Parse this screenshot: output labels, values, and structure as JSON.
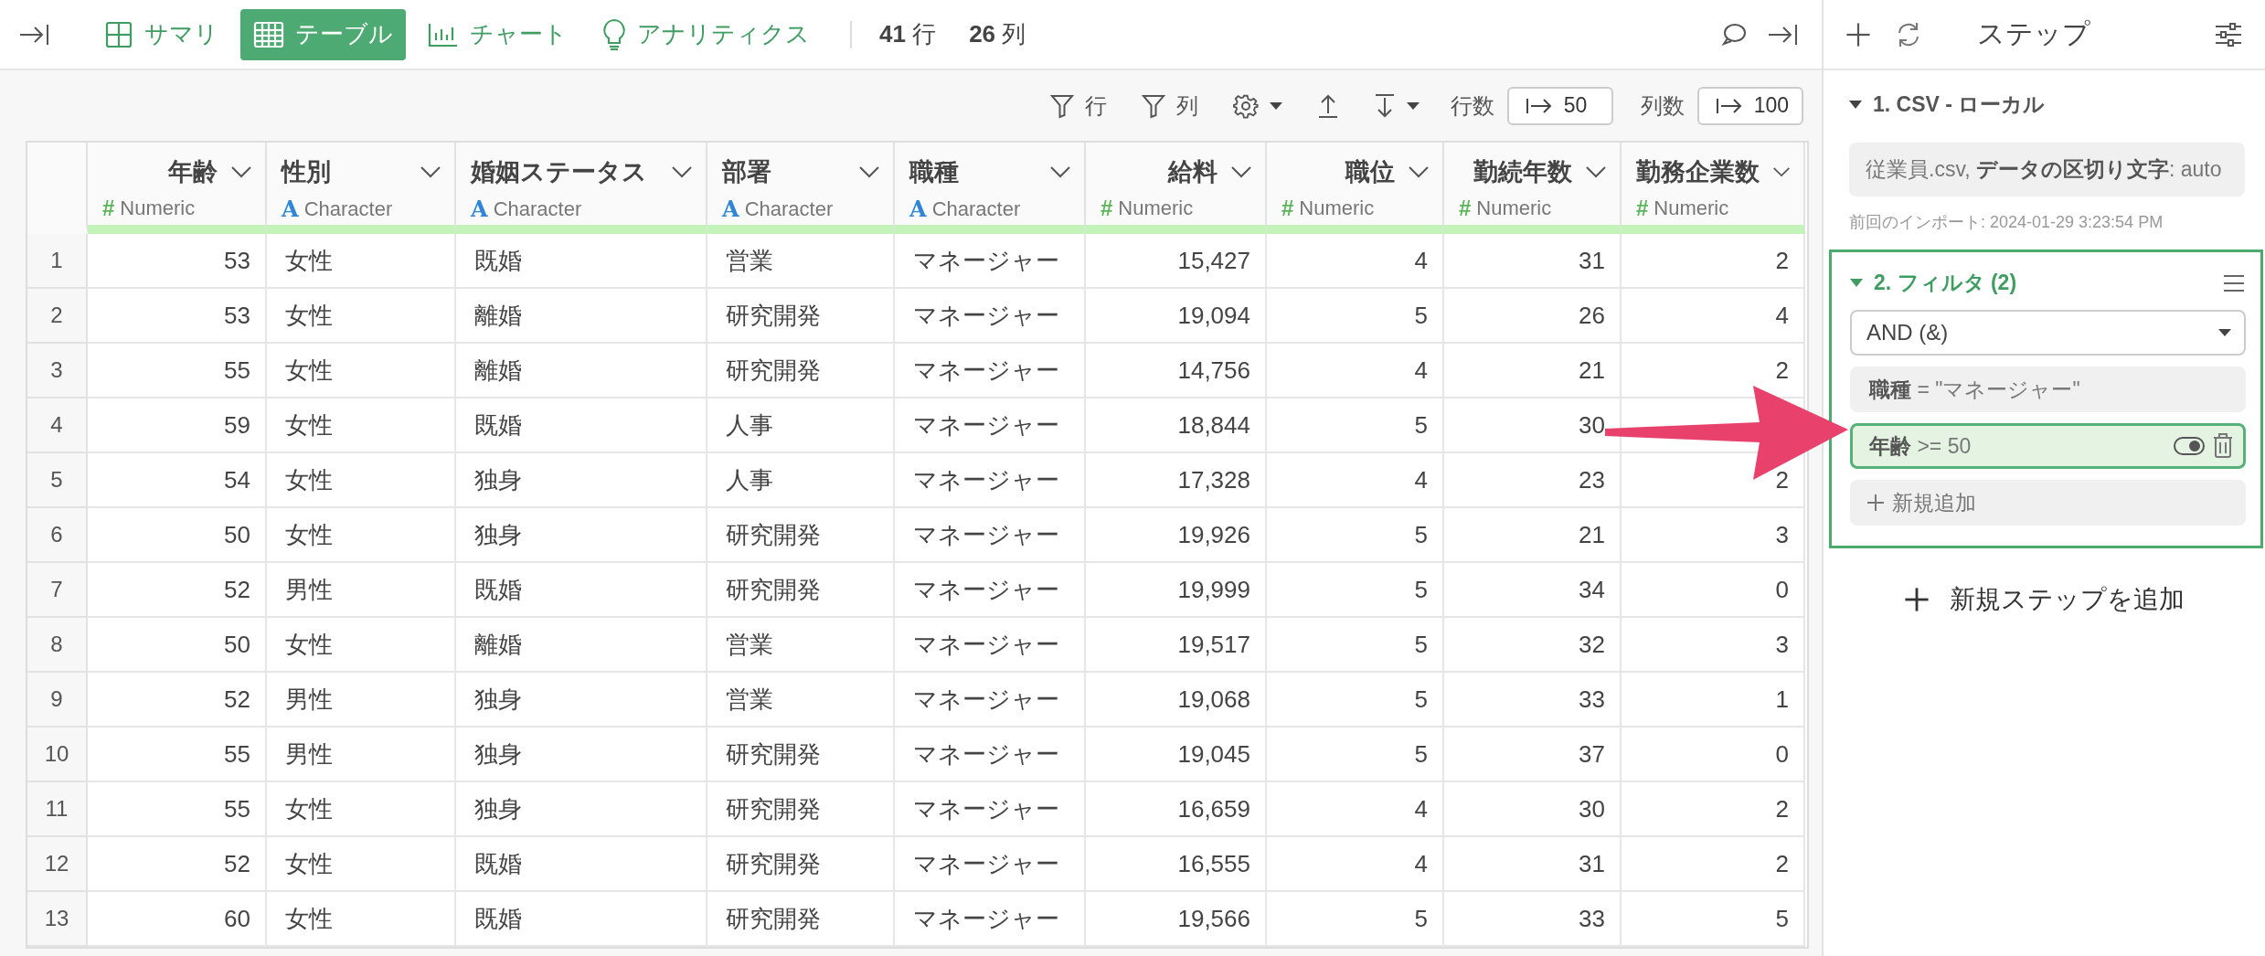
{
  "toolbar": {
    "tabs": [
      {
        "label": "サマリ",
        "kind": "summary",
        "selected": false
      },
      {
        "label": "テーブル",
        "kind": "table",
        "selected": true
      },
      {
        "label": "チャート",
        "kind": "chart",
        "selected": false
      },
      {
        "label": "アナリティクス",
        "kind": "analytics",
        "selected": false
      }
    ],
    "counts": [
      {
        "value": "41",
        "unit": "行"
      },
      {
        "value": "26",
        "unit": "列"
      }
    ]
  },
  "table_toolbar": {
    "filter_row": "行",
    "filter_column": "列",
    "row_limit_label": "行数",
    "row_limit": "50",
    "column_limit_label": "列数",
    "column_limit": "100"
  },
  "table": {
    "columns": [
      {
        "name": "年齢",
        "type": "Numeric",
        "type_icon": "#",
        "kind": "numeric"
      },
      {
        "name": "性別",
        "type": "Character",
        "type_icon": "A",
        "kind": "character"
      },
      {
        "name": "婚姻ステータス",
        "type": "Character",
        "type_icon": "A",
        "kind": "character"
      },
      {
        "name": "部署",
        "type": "Character",
        "type_icon": "A",
        "kind": "character"
      },
      {
        "name": "職種",
        "type": "Character",
        "type_icon": "A",
        "kind": "character"
      },
      {
        "name": "給料",
        "type": "Numeric",
        "type_icon": "#",
        "kind": "numeric"
      },
      {
        "name": "職位",
        "type": "Numeric",
        "type_icon": "#",
        "kind": "numeric"
      },
      {
        "name": "勤続年数",
        "type": "Numeric",
        "type_icon": "#",
        "kind": "numeric"
      },
      {
        "name": "勤務企業数",
        "type": "Numeric",
        "type_icon": "#",
        "kind": "numeric"
      }
    ],
    "rows": [
      {
        "index": "1",
        "cells": [
          "53",
          "女性",
          "既婚",
          "営業",
          "マネージャー",
          "15,427",
          "4",
          "31",
          "2"
        ]
      },
      {
        "index": "2",
        "cells": [
          "53",
          "女性",
          "離婚",
          "研究開発",
          "マネージャー",
          "19,094",
          "5",
          "26",
          "4"
        ]
      },
      {
        "index": "3",
        "cells": [
          "55",
          "女性",
          "離婚",
          "研究開発",
          "マネージャー",
          "14,756",
          "4",
          "21",
          "2"
        ]
      },
      {
        "index": "4",
        "cells": [
          "59",
          "女性",
          "既婚",
          "人事",
          "マネージャー",
          "18,844",
          "5",
          "30",
          null
        ]
      },
      {
        "index": "5",
        "cells": [
          "54",
          "女性",
          "独身",
          "人事",
          "マネージャー",
          "17,328",
          "4",
          "23",
          "2"
        ]
      },
      {
        "index": "6",
        "cells": [
          "50",
          "女性",
          "独身",
          "研究開発",
          "マネージャー",
          "19,926",
          "5",
          "21",
          "3"
        ]
      },
      {
        "index": "7",
        "cells": [
          "52",
          "男性",
          "既婚",
          "研究開発",
          "マネージャー",
          "19,999",
          "5",
          "34",
          "0"
        ]
      },
      {
        "index": "8",
        "cells": [
          "50",
          "女性",
          "離婚",
          "営業",
          "マネージャー",
          "19,517",
          "5",
          "32",
          "3"
        ]
      },
      {
        "index": "9",
        "cells": [
          "52",
          "男性",
          "独身",
          "営業",
          "マネージャー",
          "19,068",
          "5",
          "33",
          "1"
        ]
      },
      {
        "index": "10",
        "cells": [
          "55",
          "男性",
          "独身",
          "研究開発",
          "マネージャー",
          "19,045",
          "5",
          "37",
          "0"
        ]
      },
      {
        "index": "11",
        "cells": [
          "55",
          "女性",
          "独身",
          "研究開発",
          "マネージャー",
          "16,659",
          "4",
          "30",
          "2"
        ]
      },
      {
        "index": "12",
        "cells": [
          "52",
          "女性",
          "既婚",
          "研究開発",
          "マネージャー",
          "16,555",
          "4",
          "31",
          "2"
        ]
      },
      {
        "index": "13",
        "cells": [
          "60",
          "女性",
          "既婚",
          "研究開発",
          "マネージャー",
          "19,566",
          "5",
          "33",
          "5"
        ]
      }
    ]
  },
  "steps_panel": {
    "title": "ステップ",
    "steps": [
      {
        "kind": "source",
        "title": "1. CSV - ローカル",
        "expanded": true,
        "selected": false,
        "detail": "従業員.csv, **データの区切り文字**: auto",
        "meta": "前回のインポート: 2024-01-29 3:23:54 PM"
      },
      {
        "kind": "filter",
        "title": "2. フィルタ (2)",
        "expanded": true,
        "selected": true,
        "operator": "AND (&)",
        "conditions": [
          {
            "text": "**職種** = \"マネージャー\"",
            "selected": false
          },
          {
            "text": "**年齢** >= 50",
            "selected": true
          }
        ],
        "add_label": "新規追加"
      }
    ],
    "add_step_label": "新規ステップを追加"
  }
}
